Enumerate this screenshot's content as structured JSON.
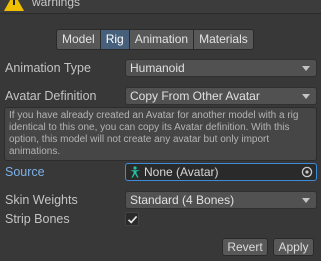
{
  "header": {
    "warning_text": "warnings"
  },
  "tabs": [
    {
      "label": "Model",
      "active": false
    },
    {
      "label": "Rig",
      "active": true
    },
    {
      "label": "Animation",
      "active": false
    },
    {
      "label": "Materials",
      "active": false
    }
  ],
  "fields": {
    "animation_type": {
      "label": "Animation Type",
      "value": "Humanoid"
    },
    "avatar_definition": {
      "label": "Avatar Definition",
      "value": "Copy From Other Avatar"
    },
    "help_text": "If you have already created an Avatar for another model with a rig identical to this one, you can copy its Avatar definition. With this option, this model will not create any avatar but only import animations.",
    "source": {
      "label": "Source",
      "value": "None (Avatar)"
    },
    "skin_weights": {
      "label": "Skin Weights",
      "value": "Standard (4 Bones)"
    },
    "strip_bones": {
      "label": "Strip Bones",
      "checked": true
    }
  },
  "buttons": {
    "revert": "Revert",
    "apply": "Apply"
  },
  "colors": {
    "active_tab": "#46607c",
    "link_label": "#7cb0e6",
    "focus_border": "#3e8bd8"
  }
}
